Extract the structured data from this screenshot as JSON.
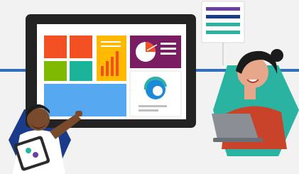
{
  "illustration": {
    "subject": "",
    "palette": {
      "background": "#f2f2f2",
      "accent_line": "#2f6fc9",
      "monitor_frame": "#232323",
      "screen_bg": "#ffffff",
      "tile_orange": "#f25022",
      "tile_amber": "#ffb900",
      "tile_green": "#7fba00",
      "tile_teal": "#1bb49a",
      "tile_blue": "#56a9f0",
      "tile_purple": "#7a1d63",
      "hex_left": "#1b3a8a",
      "hex_right": "#2ab3a0",
      "skin_dark": "#7a4a2c",
      "skin_light": "#e7a78b"
    },
    "icons": [
      "edge-browser-icon",
      "pie-chart-icon",
      "bar-chart-icon",
      "checklist-card-icon",
      "laptop-icon",
      "tablet-icon"
    ]
  }
}
